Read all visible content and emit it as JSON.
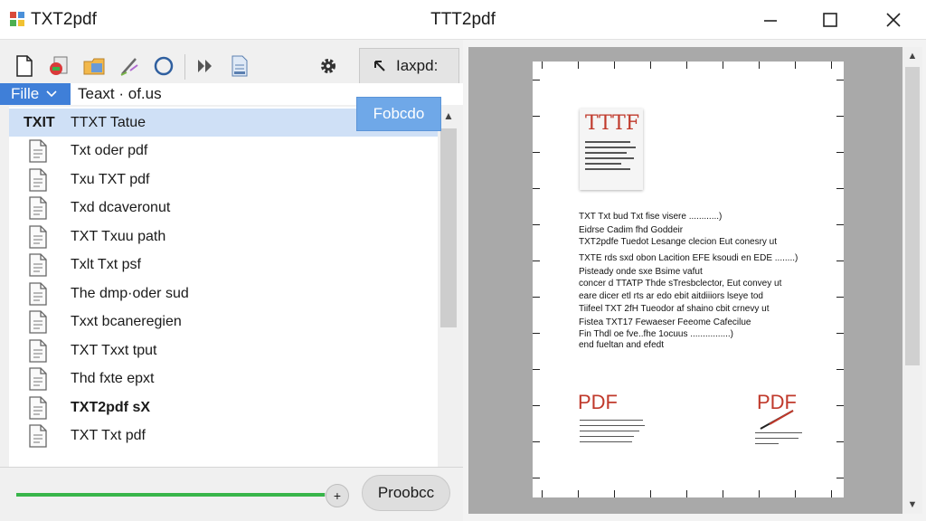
{
  "titlebar": {
    "app_name": "TXT2pdf",
    "window_title": "TTT2pdf",
    "logo_icon": "app-logo-icon"
  },
  "toolbar": {
    "icons": [
      "new-document-icon",
      "add-file-icon",
      "open-folder-icon",
      "edit-pen-icon",
      "refresh-circle-icon",
      "fast-forward-icon",
      "document-icon",
      "settings-gear-icon"
    ],
    "mode_label": "Iaxpd:"
  },
  "filebar": {
    "file_menu": "Fille",
    "text_label": "Teaxt · of.us"
  },
  "popup": {
    "label": "Fobcdo"
  },
  "file_list": [
    {
      "label": "TTXT Tatue",
      "prefix": "TXIT",
      "selected": true,
      "bold": false
    },
    {
      "label": "Txt oder pdf",
      "selected": false,
      "bold": false
    },
    {
      "label": "Txu TXT pdf",
      "selected": false,
      "bold": false
    },
    {
      "label": "Txd dcaveronut",
      "selected": false,
      "bold": false
    },
    {
      "label": "TXT Txuu path",
      "selected": false,
      "bold": false
    },
    {
      "label": "Txlt Txt psf",
      "selected": false,
      "bold": false
    },
    {
      "label": "The dmp·oder sud",
      "selected": false,
      "bold": false
    },
    {
      "label": "Txxt bcaneregien",
      "selected": false,
      "bold": false
    },
    {
      "label": "TXT Txxt tput",
      "selected": false,
      "bold": false
    },
    {
      "label": "Thd fxte epxt",
      "selected": false,
      "bold": false
    },
    {
      "label": "TXT2pdf sX",
      "selected": false,
      "bold": true
    },
    {
      "label": "TXT Txt pdf",
      "selected": false,
      "bold": false
    }
  ],
  "bottom": {
    "progress": 0.98,
    "knob_label": "+",
    "process_button": "Proobcc"
  },
  "preview": {
    "thumb_title": "TTTF",
    "lines": [
      "TXT Txt bud Txt fise visere ............)",
      "Eidrse Cadim fhd Goddeir",
      "TXT2pdfe Tuedot Lesange clecion Eut conesry ut",
      "TXTE rds sxd obon Lacition EFE ksoudi en EDE ........)",
      "Pisteady onde sxe Bsime vafut",
      "concer d TTATP Thde sTresbclector, Eut convey ut",
      "eare dicer etl rts ar edo ebit aitdiiiors lseye tod",
      "Tiifeel TXT 2fH Tueodor af shaino cbit crnevy ut",
      "Fistea TXT17 Fewaeser Feeome Cafecilue",
      "Fin Thdl oe fve..fhe 1ocuus ................)",
      "end fueltan and efedt"
    ],
    "pdf_left": "PDF",
    "pdf_right": "PDF"
  },
  "colors": {
    "accent": "#3f7fd8",
    "selection": "#cfe0f6",
    "progress": "#38b54a",
    "pdf_red": "#c0392b"
  }
}
